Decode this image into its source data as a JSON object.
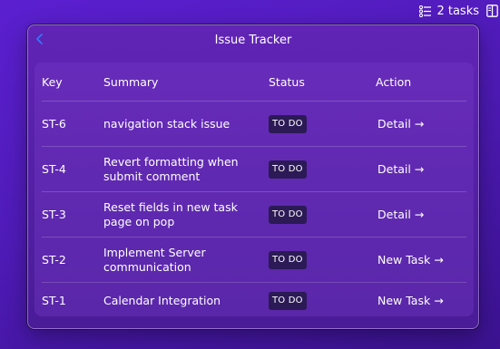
{
  "menubar": {
    "tasks_label": "2 tasks",
    "tasks_icon": "checklist-icon",
    "split_icon": "sidebar-split-icon"
  },
  "window": {
    "title": "Issue Tracker",
    "back_icon": "chevron-left-icon"
  },
  "table": {
    "headers": {
      "key": "Key",
      "summary": "Summary",
      "status": "Status",
      "action": "Action"
    },
    "rows": [
      {
        "key": "ST-6",
        "summary": "navigation stack issue",
        "status": "TO DO",
        "action": "Detail →"
      },
      {
        "key": "ST-4",
        "summary": "Revert formatting when submit comment",
        "status": "TO DO",
        "action": "Detail →"
      },
      {
        "key": "ST-3",
        "summary": "Reset fields in new task page on pop",
        "status": "TO DO",
        "action": "Detail →"
      },
      {
        "key": "ST-2",
        "summary": "Implement Server communication",
        "status": "TO DO",
        "action": "New Task →"
      },
      {
        "key": "ST-1",
        "summary": "Calendar Integration",
        "status": "TO DO",
        "action": "New Task →"
      }
    ]
  },
  "colors": {
    "background": "#4f1bb8",
    "window": "#5a22ac",
    "badge": "#2b1a55",
    "text": "#ffffff",
    "accent": "#2f7bff"
  }
}
